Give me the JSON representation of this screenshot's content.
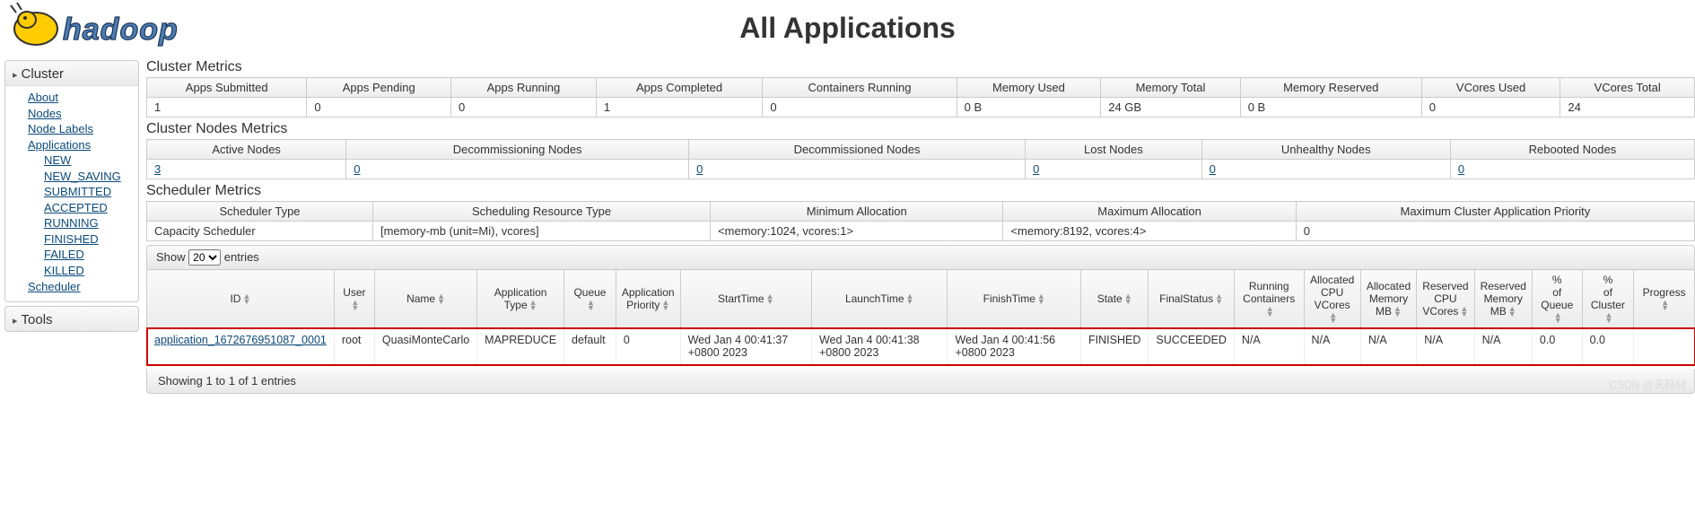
{
  "page_title": "All Applications",
  "sidebar": {
    "cluster": {
      "label": "Cluster",
      "items": [
        {
          "label": "About"
        },
        {
          "label": "Nodes"
        },
        {
          "label": "Node Labels"
        },
        {
          "label": "Applications"
        }
      ],
      "app_states": [
        {
          "label": "NEW"
        },
        {
          "label": "NEW_SAVING"
        },
        {
          "label": "SUBMITTED"
        },
        {
          "label": "ACCEPTED"
        },
        {
          "label": "RUNNING"
        },
        {
          "label": "FINISHED"
        },
        {
          "label": "FAILED"
        },
        {
          "label": "KILLED"
        }
      ],
      "scheduler": {
        "label": "Scheduler"
      }
    },
    "tools": {
      "label": "Tools"
    }
  },
  "cluster_metrics": {
    "title": "Cluster Metrics",
    "headers": [
      "Apps Submitted",
      "Apps Pending",
      "Apps Running",
      "Apps Completed",
      "Containers Running",
      "Memory Used",
      "Memory Total",
      "Memory Reserved",
      "VCores Used",
      "VCores Total"
    ],
    "values": [
      "1",
      "0",
      "0",
      "1",
      "0",
      "0 B",
      "24 GB",
      "0 B",
      "0",
      "24"
    ]
  },
  "node_metrics": {
    "title": "Cluster Nodes Metrics",
    "headers": [
      "Active Nodes",
      "Decommissioning Nodes",
      "Decommissioned Nodes",
      "Lost Nodes",
      "Unhealthy Nodes",
      "Rebooted Nodes"
    ],
    "values": [
      "3",
      "0",
      "0",
      "0",
      "0",
      "0"
    ]
  },
  "scheduler_metrics": {
    "title": "Scheduler Metrics",
    "headers": [
      "Scheduler Type",
      "Scheduling Resource Type",
      "Minimum Allocation",
      "Maximum Allocation",
      "Maximum Cluster Application Priority"
    ],
    "values": [
      "Capacity Scheduler",
      "[memory-mb (unit=Mi), vcores]",
      "<memory:1024, vcores:1>",
      "<memory:8192, vcores:4>",
      "0"
    ]
  },
  "datatable": {
    "show_prefix": "Show",
    "show_value": "20",
    "show_suffix": "entries",
    "columns": [
      "ID",
      "User",
      "Name",
      "Application Type",
      "Queue",
      "Application Priority",
      "StartTime",
      "LaunchTime",
      "FinishTime",
      "State",
      "FinalStatus",
      "Running Containers",
      "Allocated CPU VCores",
      "Allocated Memory MB",
      "Reserved CPU VCores",
      "Reserved Memory MB",
      "% of Queue",
      "% of Cluster",
      "Progress"
    ],
    "rows": [
      {
        "id": "application_1672676951087_0001",
        "user": "root",
        "name": "QuasiMonteCarlo",
        "type": "MAPREDUCE",
        "queue": "default",
        "priority": "0",
        "start": "Wed Jan 4 00:41:37 +0800 2023",
        "launch": "Wed Jan 4 00:41:38 +0800 2023",
        "finish": "Wed Jan 4 00:41:56 +0800 2023",
        "state": "FINISHED",
        "final": "SUCCEEDED",
        "running_containers": "N/A",
        "alloc_vcores": "N/A",
        "alloc_mem": "N/A",
        "res_vcores": "N/A",
        "res_mem": "N/A",
        "pct_queue": "0.0",
        "pct_cluster": "0.0"
      }
    ],
    "footer": "Showing 1 to 1 of 1 entries"
  },
  "watermark": "CSDN @天码村"
}
